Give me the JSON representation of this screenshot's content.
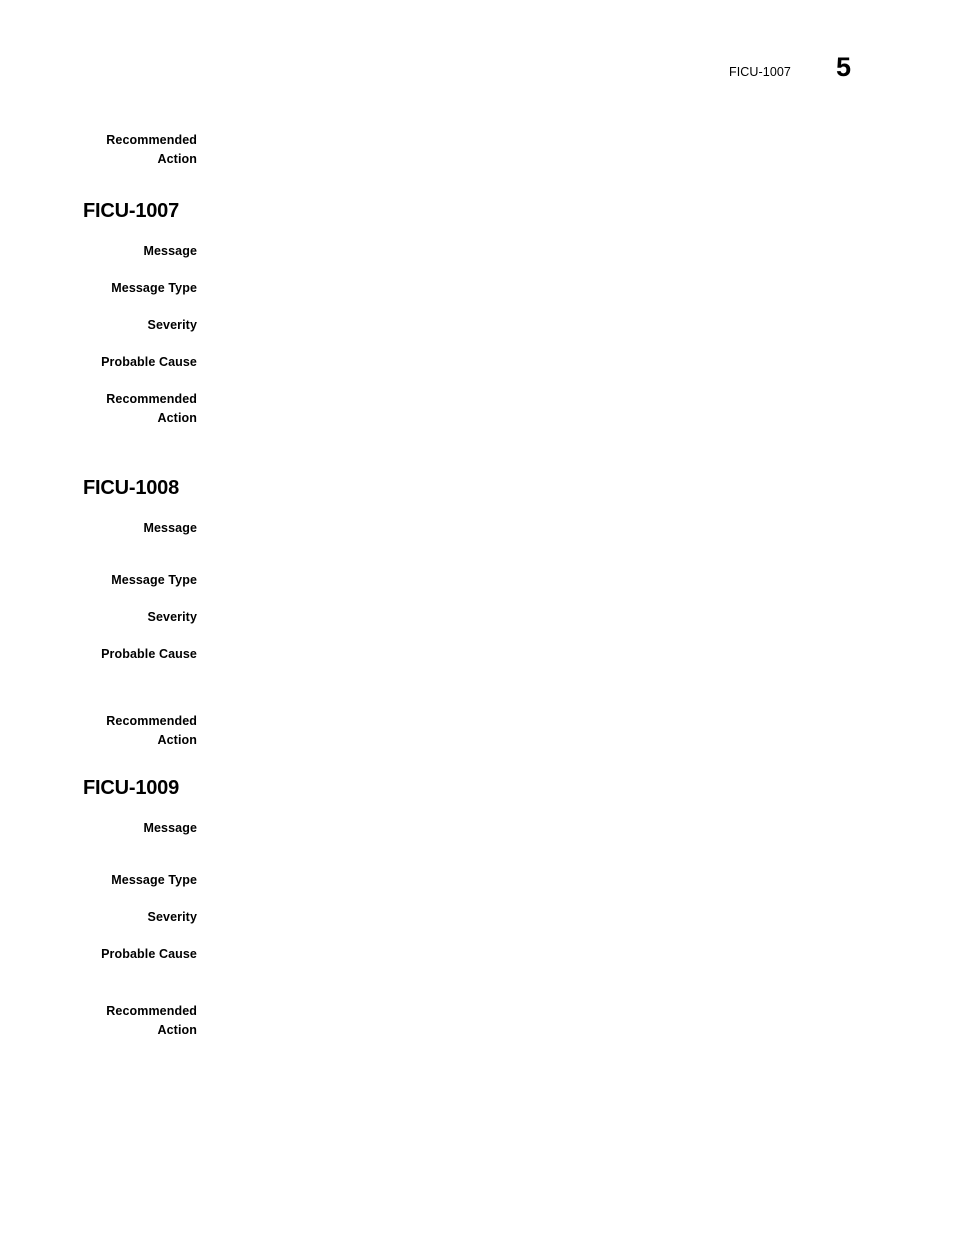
{
  "page": {
    "running_header_title": "FICU-1007",
    "page_number": "5"
  },
  "labels": {
    "message": "Message",
    "message_type": "Message Type",
    "severity": "Severity",
    "probable_cause": "Probable Cause",
    "recommended_action": "Recommended\nAction"
  },
  "continued_section": {
    "recommended_action_label": "Recommended\nAction",
    "recommended_action_value": ""
  },
  "sections": [
    {
      "heading": "FICU-1007",
      "fields": [
        {
          "label": "Message",
          "value": ""
        },
        {
          "label": "Message Type",
          "value": ""
        },
        {
          "label": "Severity",
          "value": ""
        },
        {
          "label": "Probable Cause",
          "value": ""
        },
        {
          "label": "Recommended\nAction",
          "value": ""
        }
      ]
    },
    {
      "heading": "FICU-1008",
      "fields": [
        {
          "label": "Message",
          "value": ""
        },
        {
          "label": "Message Type",
          "value": ""
        },
        {
          "label": "Severity",
          "value": ""
        },
        {
          "label": "Probable Cause",
          "value": ""
        },
        {
          "label": "Recommended\nAction",
          "value": ""
        }
      ]
    },
    {
      "heading": "FICU-1009",
      "fields": [
        {
          "label": "Message",
          "value": ""
        },
        {
          "label": "Message Type",
          "value": ""
        },
        {
          "label": "Severity",
          "value": ""
        },
        {
          "label": "Probable Cause",
          "value": ""
        },
        {
          "label": "Recommended\nAction",
          "value": ""
        }
      ]
    }
  ]
}
